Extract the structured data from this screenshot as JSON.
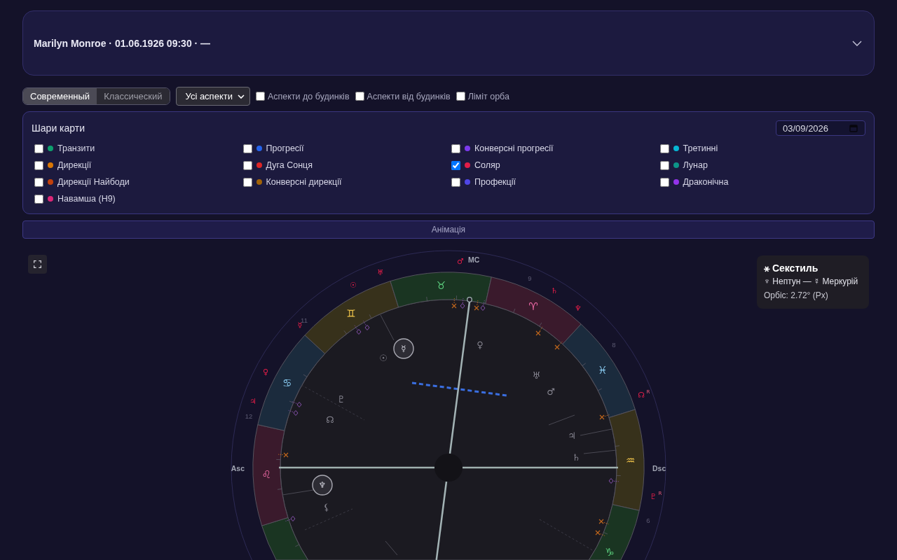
{
  "header": {
    "title": "Marilyn Monroe · 01.06.1926 09:30 · —",
    "expanded": false
  },
  "toolbar": {
    "modes": [
      {
        "label": "Современный",
        "selected": true
      },
      {
        "label": "Классический",
        "selected": false
      }
    ],
    "aspect_filter": {
      "value": "Усі аспекти"
    },
    "options": [
      {
        "label": "Аспекти до будинків",
        "checked": false
      },
      {
        "label": "Аспекти від будинків",
        "checked": false
      },
      {
        "label": "Ліміт орба",
        "checked": false
      }
    ]
  },
  "layers": {
    "title": "Шари карти",
    "date": "03/09/2026",
    "items": [
      {
        "label": "Транзити",
        "color": "#0e9f6e",
        "checked": false
      },
      {
        "label": "Прогресії",
        "color": "#2563eb",
        "checked": false
      },
      {
        "label": "Конверсні прогресії",
        "color": "#7c3aed",
        "checked": false
      },
      {
        "label": "Третинні",
        "color": "#06b6d4",
        "checked": false
      },
      {
        "label": "Дирекції",
        "color": "#d97706",
        "checked": false
      },
      {
        "label": "Дуга Сонця",
        "color": "#dc2626",
        "checked": false
      },
      {
        "label": "Соляр",
        "color": "#e11d48",
        "checked": true
      },
      {
        "label": "Лунар",
        "color": "#0d9488",
        "checked": false
      },
      {
        "label": "Дирекції Найбоди",
        "color": "#c2410c",
        "checked": false
      },
      {
        "label": "Конверсні дирекції",
        "color": "#a16207",
        "checked": false
      },
      {
        "label": "Профекції",
        "color": "#4f46e5",
        "checked": false
      },
      {
        "label": "Драконічна",
        "color": "#9333ea",
        "checked": false
      },
      {
        "label": "Навамша (H9)",
        "color": "#db2777",
        "checked": false
      }
    ]
  },
  "animation": {
    "label": "Анімація"
  },
  "chart": {
    "angles": [
      "MC",
      "Asc",
      "Dsc"
    ],
    "house_numbers": [
      "9",
      "11",
      "8",
      "12",
      "6"
    ],
    "signs": [
      {
        "kind": "earth"
      },
      {
        "glyph": "♌",
        "kind": "fire"
      },
      {
        "glyph": "♋",
        "kind": "water"
      },
      {
        "glyph": "♊",
        "kind": "air"
      },
      {
        "glyph": "♉",
        "kind": "earth"
      },
      {
        "glyph": "♈",
        "kind": "fire"
      },
      {
        "glyph": "♓",
        "kind": "water"
      },
      {
        "glyph": "♒",
        "kind": "air"
      },
      {
        "glyph": "♑",
        "kind": "earth"
      }
    ],
    "natal_planets": [
      {
        "glyph": "♀",
        "highlighted": false
      },
      {
        "glyph": "☿",
        "highlighted": true
      },
      {
        "glyph": "☉",
        "highlighted": false
      },
      {
        "glyph": "♅",
        "highlighted": false
      },
      {
        "glyph": "♂",
        "highlighted": false
      },
      {
        "glyph": "♇",
        "highlighted": false
      },
      {
        "glyph": "☊",
        "highlighted": false
      },
      {
        "glyph": "♃",
        "highlighted": false
      },
      {
        "glyph": "♄",
        "highlighted": false
      },
      {
        "glyph": "♆",
        "highlighted": true
      },
      {
        "glyph": "⚸",
        "highlighted": false
      }
    ],
    "solar_planets": [
      {
        "glyph": "♂"
      },
      {
        "glyph": "♅"
      },
      {
        "glyph": "☉"
      },
      {
        "glyph": "♄"
      },
      {
        "glyph": "♆"
      },
      {
        "glyph": "☿"
      },
      {
        "glyph": "♀"
      },
      {
        "glyph": "☊",
        "marker": "R"
      },
      {
        "glyph": "♃"
      },
      {
        "glyph": "♇",
        "marker": "R"
      }
    ]
  },
  "tooltip": {
    "title": "⚹ Секстиль",
    "pair": "♆ Нептун — ☿ Меркурій",
    "orb": "Орбіс: 2.72° (Px)"
  }
}
